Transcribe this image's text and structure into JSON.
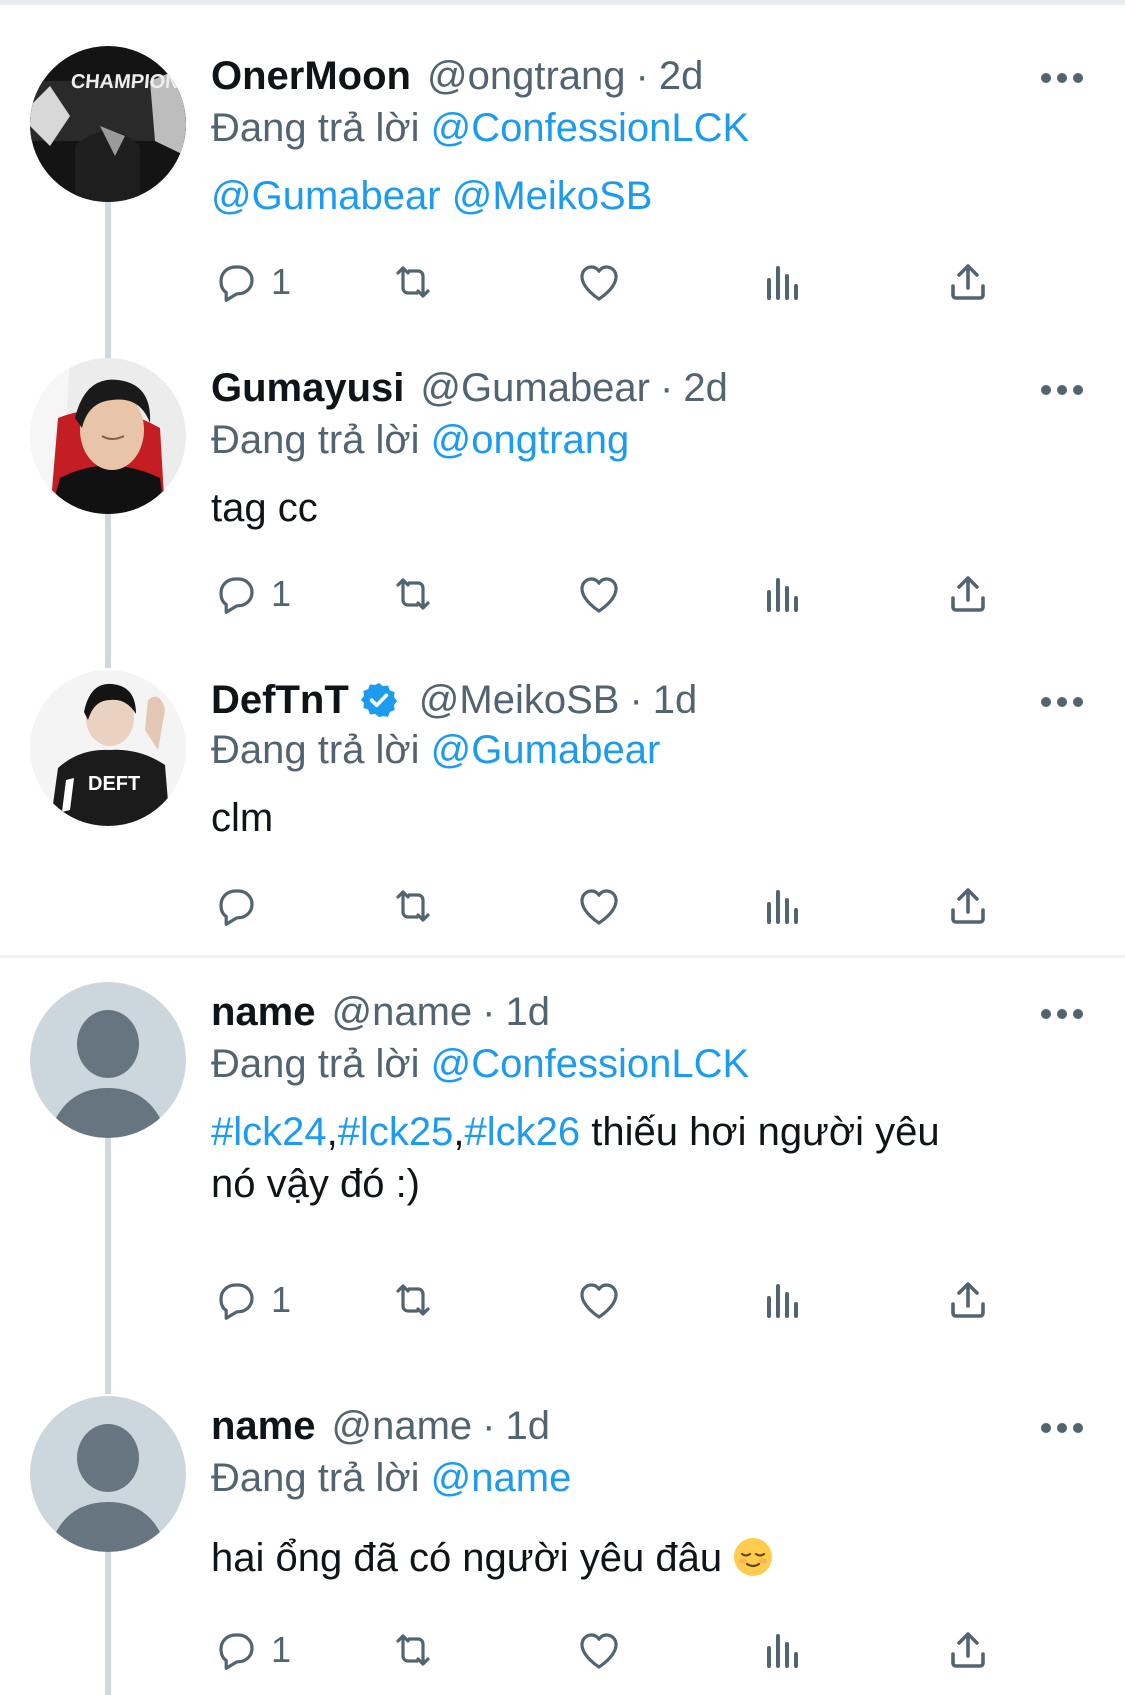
{
  "ui": {
    "reply_prefix": "Đang trả lời",
    "dot": "·",
    "link_color": "#1d9bf0",
    "secondary_text_color": "#536471",
    "icons": [
      "reply-icon",
      "retweet-icon",
      "like-icon",
      "views-icon",
      "share-icon",
      "more-icon",
      "verified-badge-icon"
    ]
  },
  "tweets": [
    {
      "name": "OnerMoon",
      "handle": "@ongtrang",
      "time": "2d",
      "replying_to": "@ConfessionLCK",
      "text_mentions": [
        "@Gumabear",
        "@MeikoSB"
      ],
      "reply_count": "1",
      "avatar_text": "CHAMPION"
    },
    {
      "name": "Gumayusi",
      "handle": "@Gumabear",
      "time": "2d",
      "replying_to": "@ongtrang",
      "text": "tag cc",
      "reply_count": "1"
    },
    {
      "name": "DefTnT",
      "handle": "@MeikoSB",
      "time": "1d",
      "verified": true,
      "replying_to": "@Gumabear",
      "text": "clm",
      "reply_count": "",
      "avatar_text": "DEFT"
    },
    {
      "name": "name",
      "handle": "@name",
      "time": "1d",
      "replying_to": "@ConfessionLCK",
      "hashtags": [
        "#lck24",
        "#lck25",
        "#lck26"
      ],
      "separator": ",",
      "text_line1": " thiếu hơi người yêu",
      "text_line2": "nó vậy đó :)",
      "reply_count": "1"
    },
    {
      "name": "name",
      "handle": "@name",
      "time": "1d",
      "replying_to": "@name",
      "text": "hai ổng đã có người yêu đâu",
      "emoji": "relieved-face-emoji",
      "reply_count": "1"
    }
  ]
}
